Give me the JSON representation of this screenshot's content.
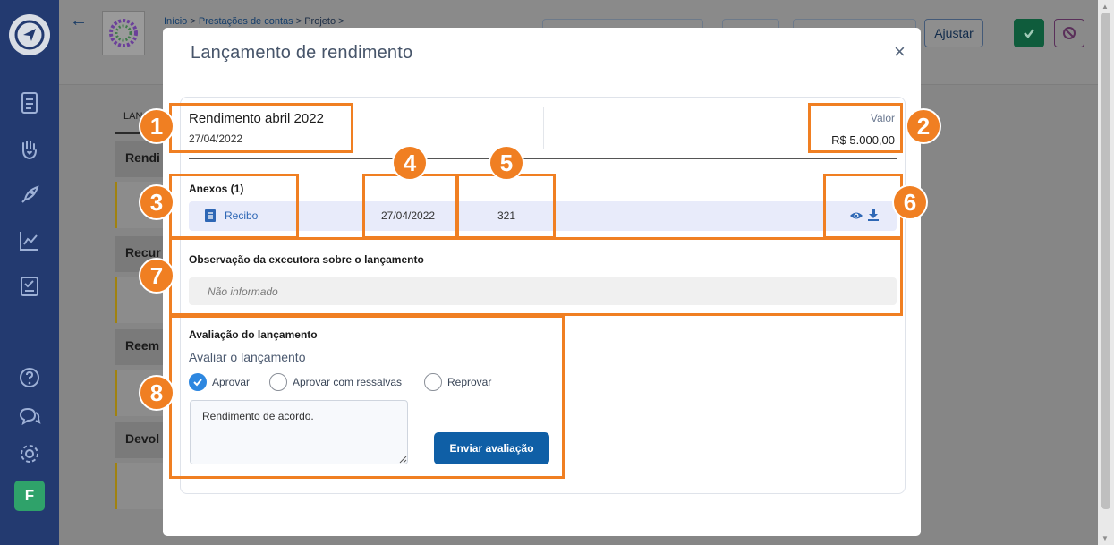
{
  "sidebar": {
    "items": [
      "logo-icon",
      "document-icon",
      "hand-heart-icon",
      "rocket-icon",
      "chart-icon",
      "notebook-icon",
      "help-icon",
      "chat-icon",
      "gear-icon"
    ],
    "avatar_letter": "F"
  },
  "background": {
    "breadcrumb": {
      "home": "Início",
      "sep1": ">",
      "section": "Prestações de contas",
      "sep2": ">",
      "current": "Projeto",
      "sep3": ">"
    },
    "adjust_button": "Ajustar",
    "tab_label": "LAN",
    "sections": [
      "Rendi",
      "Recur",
      "Reem",
      "Devol"
    ]
  },
  "modal": {
    "title": "Lançamento de rendimento",
    "close_symbol": "×",
    "entry": {
      "title": "Rendimento abril 2022",
      "date": "27/04/2022",
      "value_label": "Valor",
      "value": "R$ 5.000,00"
    },
    "attachments": {
      "title": "Anexos (1)",
      "items": [
        {
          "name": "Recibo",
          "date": "27/04/2022",
          "number": "321"
        }
      ]
    },
    "observation": {
      "title": "Observação da executora sobre o lançamento",
      "text": "Não informado"
    },
    "evaluation": {
      "title": "Avaliação do lançamento",
      "subtitle": "Avaliar o lançamento",
      "options": [
        "Aprovar",
        "Aprovar com ressalvas",
        "Reprovar"
      ],
      "selected": "Aprovar",
      "comment": "Rendimento de acordo.",
      "submit_label": "Enviar avaliação"
    }
  },
  "annotations": {
    "badges": [
      "1",
      "2",
      "3",
      "4",
      "5",
      "6",
      "7",
      "8"
    ],
    "color": "#f07f22"
  },
  "colors": {
    "sidebar": "#233a70",
    "primary_button": "#0f5fa6",
    "link": "#2e67b5",
    "radio_checked": "#2d87e0",
    "avatar": "#2fa26a"
  }
}
